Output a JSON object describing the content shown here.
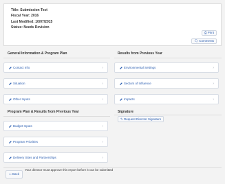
{
  "report": {
    "title_line": "Title: Submission Test",
    "fiscal_line": "Fiscal Year: 2016",
    "modified_line": "Last Modified: 10/07/2015",
    "status_line": "Status: Needs Revision"
  },
  "actions": {
    "print_label": "Print",
    "comments_label": "Comments"
  },
  "left": {
    "section1_title": "General Information & Program Plan",
    "section1_items": [
      "Contact Info",
      "Situation",
      "Other Inputs"
    ],
    "section2_title": "Program Plan & Results from Previous Year",
    "section2_items": [
      "Budget Inputs",
      "Program Priorities",
      "Delivery Sites and Partnerships"
    ]
  },
  "right": {
    "section1_title": "Results from Previous Year",
    "section1_items": [
      "Environmental Settings",
      "Sectors of Influence",
      "Impacts"
    ],
    "signature_title": "Signature",
    "request_label": "Request Director Signature"
  },
  "footer": {
    "back_label": "Back",
    "note": "Your director must approve this report before it can be submitted"
  },
  "colors": {
    "accent": "#2a5db0",
    "border": "#dcdcdc"
  }
}
